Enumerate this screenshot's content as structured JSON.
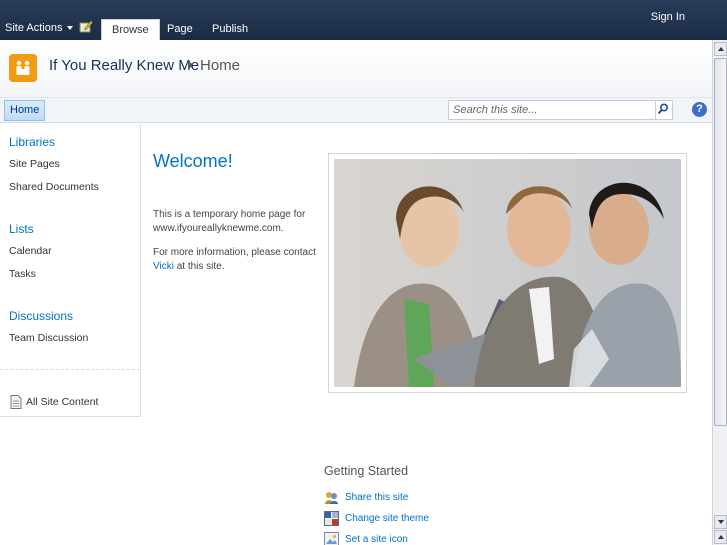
{
  "ribbon": {
    "site_actions": "Site Actions",
    "tabs": [
      "Browse",
      "Page",
      "Publish"
    ],
    "sign_in": "Sign In"
  },
  "header": {
    "site_title": "If You Really Knew Me",
    "breadcrumb_current": "Home"
  },
  "topnav": {
    "home": "Home",
    "search_placeholder": "Search this site..."
  },
  "quicklaunch": {
    "libraries": {
      "heading": "Libraries",
      "items": [
        "Site Pages",
        "Shared Documents"
      ]
    },
    "lists": {
      "heading": "Lists",
      "items": [
        "Calendar",
        "Tasks"
      ]
    },
    "discussions": {
      "heading": "Discussions",
      "items": [
        "Team Discussion"
      ]
    },
    "all_site_content": "All Site Content"
  },
  "main": {
    "welcome": "Welcome!",
    "para1": "This is a temporary home page for www.ifyoureallyknewme.com.",
    "para2_before": "For more information, please contact ",
    "para2_link": "Vicki",
    "para2_after": " at this site."
  },
  "getting_started": {
    "title": "Getting Started",
    "items": [
      "Share this site",
      "Change site theme",
      "Set a site icon"
    ]
  },
  "colors": {
    "ribbon": "#1f3150",
    "link": "#0072c6",
    "logo": "#f39a13"
  }
}
